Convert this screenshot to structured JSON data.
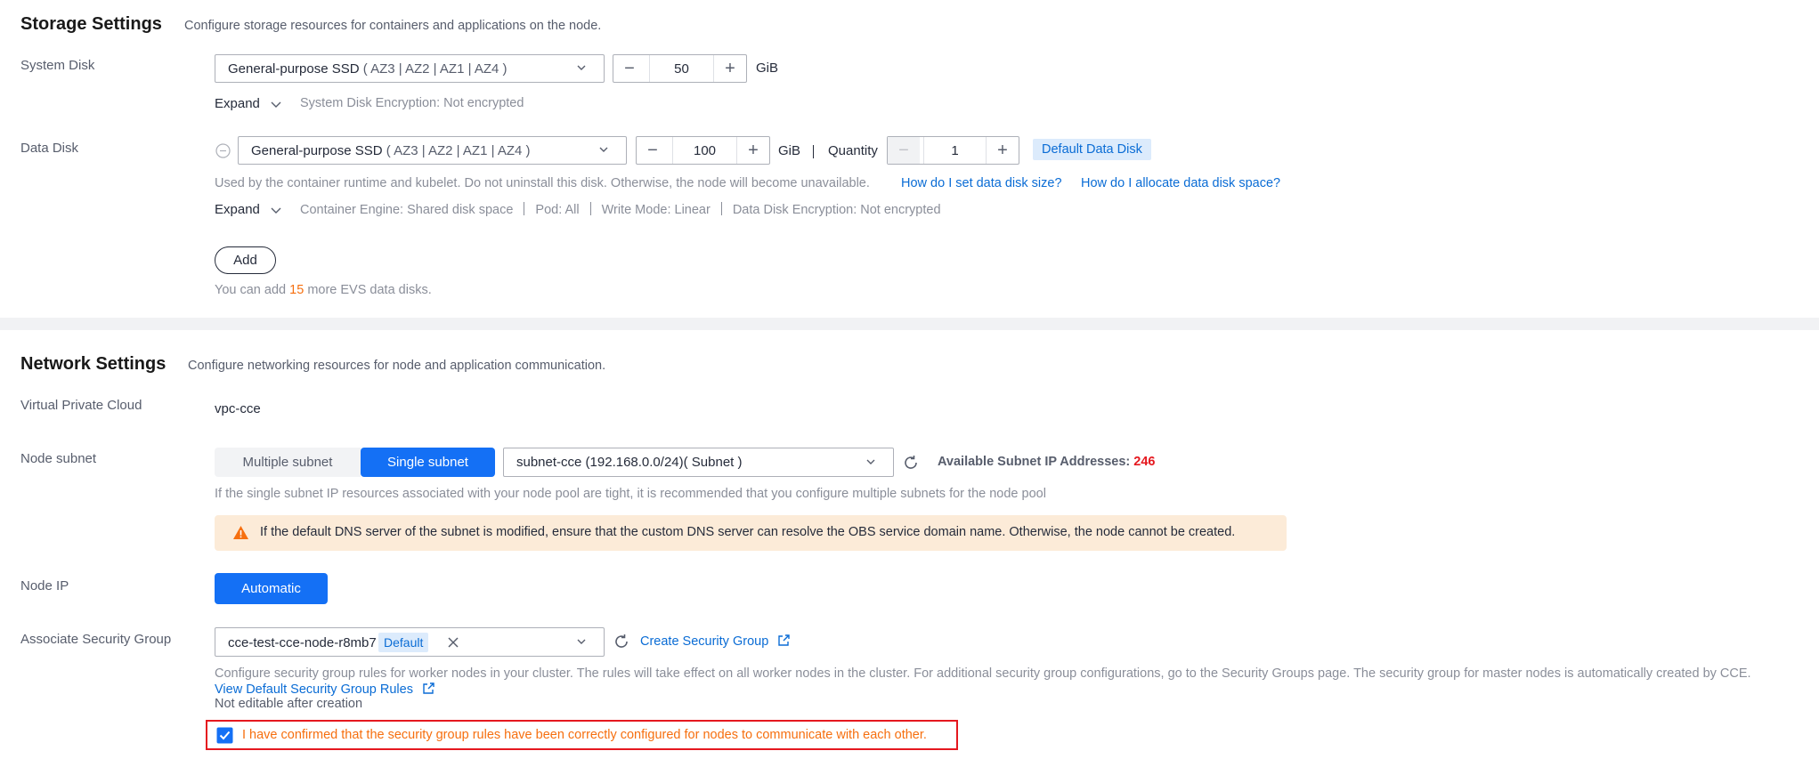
{
  "storage": {
    "title": "Storage Settings",
    "description": "Configure storage resources for containers and applications on the node.",
    "system_disk": {
      "label": "System Disk",
      "type": "General-purpose SSD",
      "zones": "( AZ3 | AZ2 | AZ1 | AZ4 )",
      "size": "50",
      "unit": "GiB",
      "expand_label": "Expand",
      "encryption": "System Disk Encryption: Not encrypted"
    },
    "data_disk": {
      "label": "Data Disk",
      "type": "General-purpose SSD",
      "zones": "( AZ3 | AZ2 | AZ1 | AZ4 )",
      "size": "100",
      "unit": "GiB",
      "quantity_label": "Quantity",
      "quantity": "1",
      "default_tag": "Default Data Disk",
      "notice": "Used by the container runtime and kubelet. Do not uninstall this disk. Otherwise, the node will become unavailable.",
      "link_size": "How do I set data disk size?",
      "link_allocate": "How do I allocate data disk space?",
      "expand_label": "Expand",
      "engine": "Container Engine: Shared disk space",
      "pod": "Pod: All",
      "write_mode": "Write Mode: Linear",
      "encryption": "Data Disk Encryption: Not encrypted",
      "add_label": "Add",
      "more_prefix": "You can add",
      "more_count": "15",
      "more_suffix": "more EVS data disks."
    }
  },
  "network": {
    "title": "Network Settings",
    "description": "Configure networking resources for node and application communication.",
    "vpc_label": "Virtual Private Cloud",
    "vpc_value": "vpc-cce",
    "subnet_label": "Node subnet",
    "seg_multiple": "Multiple subnet",
    "seg_single": "Single subnet",
    "subnet_value": "subnet-cce (192.168.0.0/24)( Subnet )",
    "available_label": "Available Subnet IP Addresses:",
    "available_count": "246",
    "subnet_hint": "If the single subnet IP resources associated with your node pool are tight, it is recommended that you configure multiple subnets for the node pool",
    "dns_warning": "If the default DNS server of the subnet is modified, ensure that the custom DNS server can resolve the OBS service domain name. Otherwise, the node cannot be created.",
    "node_ip_label": "Node IP",
    "node_ip_value": "Automatic",
    "sg_label": "Associate Security Group",
    "sg_value": "cce-test-cce-node-r8mb7",
    "sg_default_tag": "Default",
    "create_sg_link": "Create Security Group",
    "sg_hint": "Configure security group rules for worker nodes in your cluster. The rules will take effect on all worker nodes in the cluster. For additional security group configurations, go to the Security Groups page. The security group for master nodes is automatically created by CCE.",
    "view_rules_link": "View Default Security Group Rules",
    "not_editable": "Not editable after creation",
    "confirm_text": "I have confirmed that the security group rules have been correctly configured for nodes to communicate with each other."
  },
  "colors": {
    "accent": "#1470f5",
    "link": "#0a6cd5",
    "orange": "#f66f0f",
    "danger": "#e5181f"
  }
}
